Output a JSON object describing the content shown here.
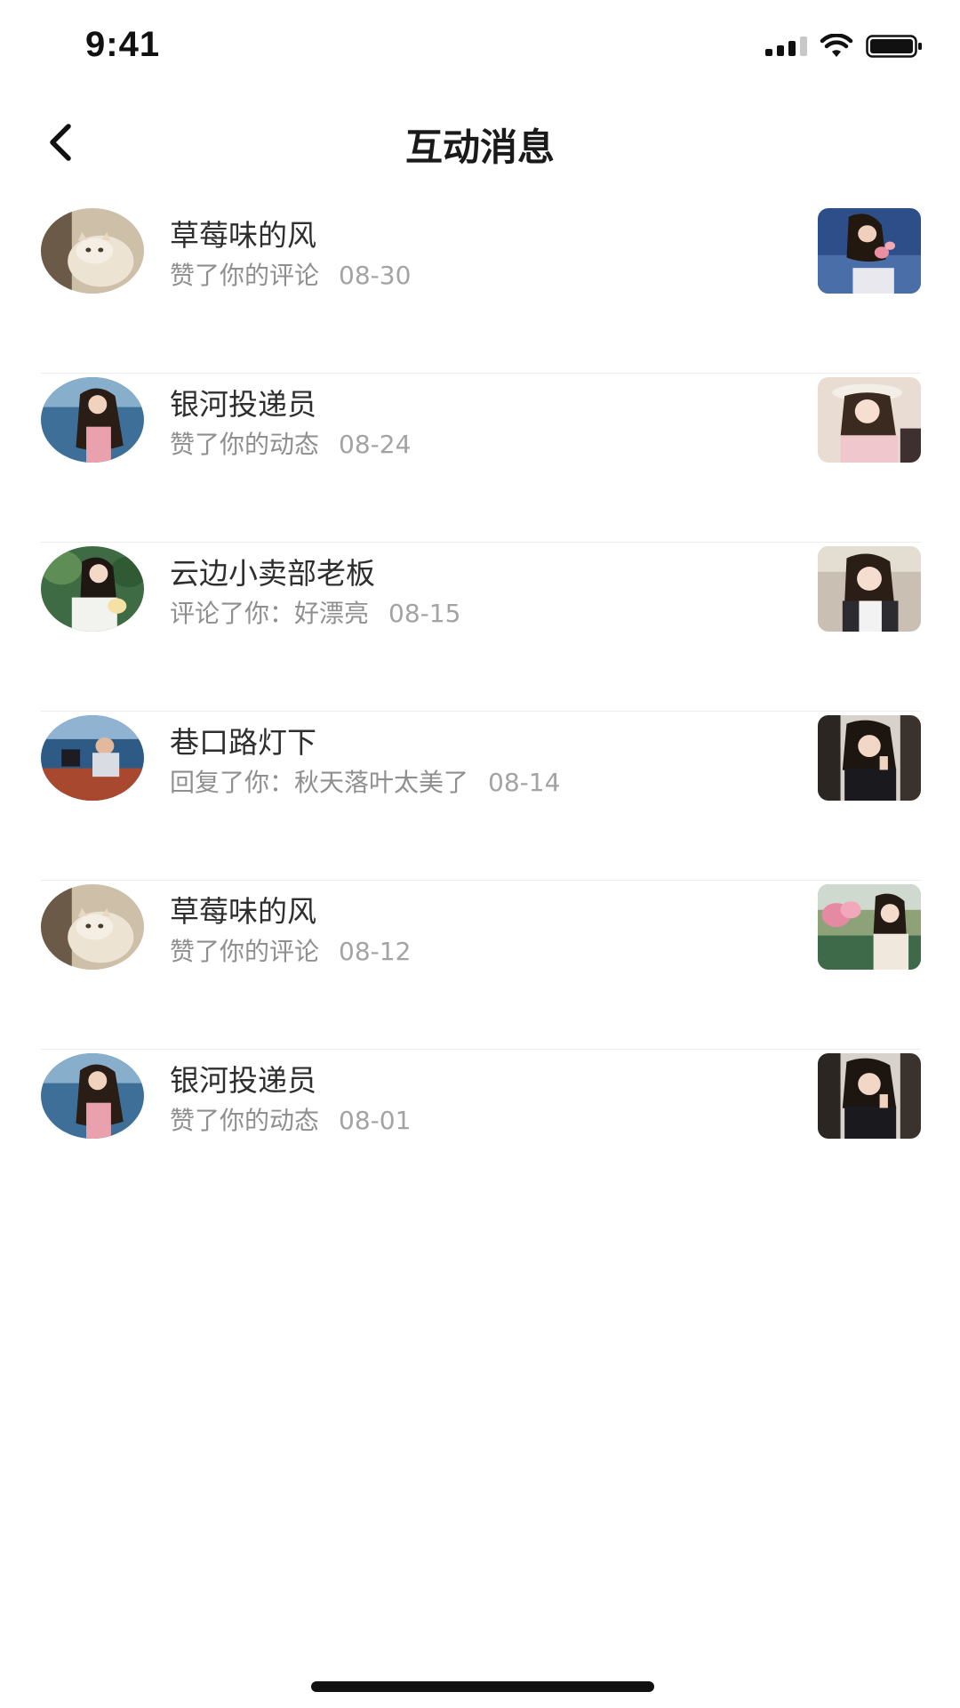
{
  "status_bar": {
    "time": "9:41"
  },
  "nav": {
    "title": "互动消息"
  },
  "messages": [
    {
      "name": "草莓味的风",
      "action": "赞了你的评论",
      "date": "08-30",
      "avatar": "avatar-cat",
      "thumb": "thumb-flowers"
    },
    {
      "name": "银河投递员",
      "action": "赞了你的动态",
      "date": "08-24",
      "avatar": "avatar-sea",
      "thumb": "thumb-hat"
    },
    {
      "name": "云边小卖部老板",
      "action": "评论了你：好漂亮",
      "date": "08-15",
      "avatar": "avatar-garden",
      "thumb": "thumb-car"
    },
    {
      "name": "巷口路灯下",
      "action": "回复了你：秋天落叶太美了",
      "date": "08-14",
      "avatar": "avatar-boat",
      "thumb": "thumb-peace"
    },
    {
      "name": "草莓味的风",
      "action": "赞了你的评论",
      "date": "08-12",
      "avatar": "avatar-cat",
      "thumb": "thumb-park"
    },
    {
      "name": "银河投递员",
      "action": "赞了你的动态",
      "date": "08-01",
      "avatar": "avatar-sea",
      "thumb": "thumb-peace"
    }
  ]
}
